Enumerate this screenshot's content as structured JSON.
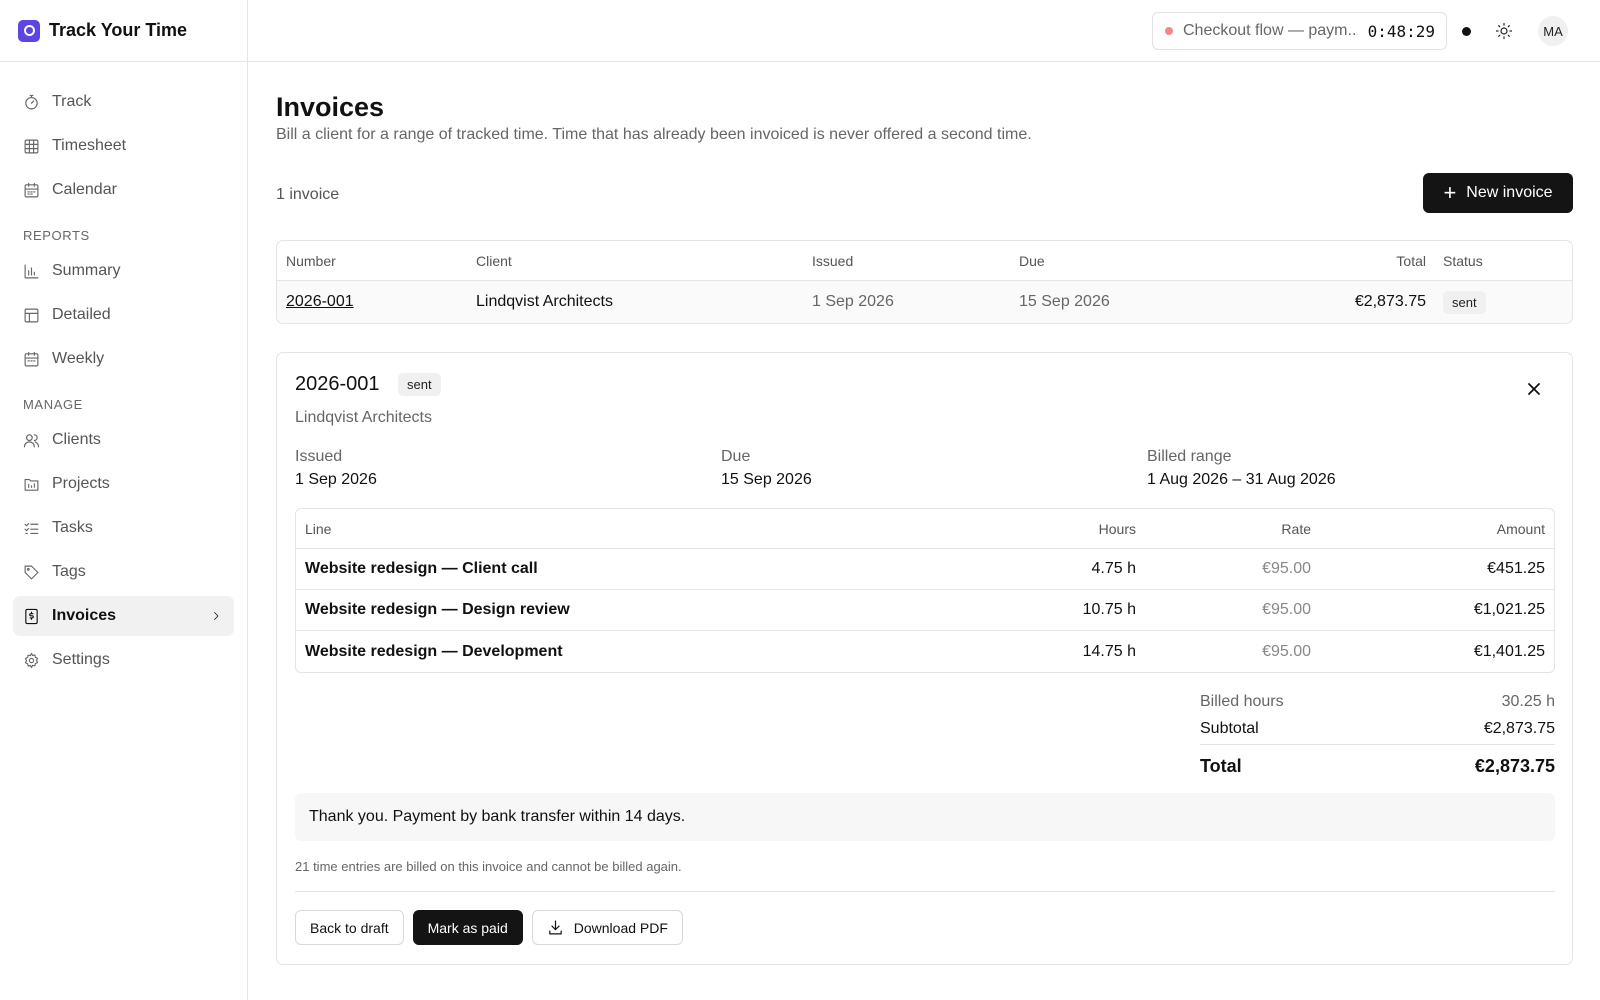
{
  "app": {
    "title": "Track Your Time"
  },
  "sidebar": {
    "top_items": [
      {
        "label": "Track",
        "icon": "stopwatch-icon"
      },
      {
        "label": "Timesheet",
        "icon": "grid-icon"
      },
      {
        "label": "Calendar",
        "icon": "calendar-icon"
      }
    ],
    "reports_heading": "REPORTS",
    "reports_items": [
      {
        "label": "Summary",
        "icon": "bar-chart-icon"
      },
      {
        "label": "Detailed",
        "icon": "table-icon"
      },
      {
        "label": "Weekly",
        "icon": "calendar-week-icon"
      }
    ],
    "manage_heading": "MANAGE",
    "manage_items": [
      {
        "label": "Clients",
        "icon": "users-icon"
      },
      {
        "label": "Projects",
        "icon": "folder-icon"
      },
      {
        "label": "Tasks",
        "icon": "checklist-icon"
      },
      {
        "label": "Tags",
        "icon": "tag-icon"
      },
      {
        "label": "Invoices",
        "icon": "invoice-icon",
        "active": true
      },
      {
        "label": "Settings",
        "icon": "gear-icon"
      }
    ]
  },
  "topbar": {
    "timer_label": "Checkout flow — paym...",
    "timer_time": "0:48:29",
    "avatar_initials": "MA"
  },
  "page": {
    "title": "Invoices",
    "subtitle": "Bill a client for a range of tracked time. Time that has already been invoiced is never offered a second time.",
    "count": "1 invoice",
    "new_button": "New invoice"
  },
  "invoice_table": {
    "headers": {
      "number": "Number",
      "client": "Client",
      "issued": "Issued",
      "due": "Due",
      "total": "Total",
      "status": "Status"
    },
    "rows": [
      {
        "number": "2026-001",
        "client": "Lindqvist Architects",
        "issued": "1 Sep 2026",
        "due": "15 Sep 2026",
        "total": "€2,873.75",
        "status": "sent"
      }
    ]
  },
  "detail": {
    "number": "2026-001",
    "status": "sent",
    "client": "Lindqvist Architects",
    "issued_label": "Issued",
    "issued": "1 Sep 2026",
    "due_label": "Due",
    "due": "15 Sep 2026",
    "range_label": "Billed range",
    "range": "1 Aug 2026 – 31 Aug 2026",
    "lines_headers": {
      "line": "Line",
      "hours": "Hours",
      "rate": "Rate",
      "amount": "Amount"
    },
    "lines": [
      {
        "line": "Website redesign — Client call",
        "hours": "4.75 h",
        "rate": "€95.00",
        "amount": "€451.25"
      },
      {
        "line": "Website redesign — Design review",
        "hours": "10.75 h",
        "rate": "€95.00",
        "amount": "€1,021.25"
      },
      {
        "line": "Website redesign — Development",
        "hours": "14.75 h",
        "rate": "€95.00",
        "amount": "€1,401.25"
      }
    ],
    "totals": {
      "billed_hours_label": "Billed hours",
      "billed_hours": "30.25 h",
      "subtotal_label": "Subtotal",
      "subtotal": "€2,873.75",
      "total_label": "Total",
      "total": "€2,873.75"
    },
    "note": "Thank you. Payment by bank transfer within 14 days.",
    "billed_note": "21 time entries are billed on this invoice and cannot be billed again.",
    "actions": {
      "back_to_draft": "Back to draft",
      "mark_paid": "Mark as paid",
      "download_pdf": "Download PDF"
    }
  },
  "colors": {
    "brand": "#5b46e5",
    "primary_button": "#141414",
    "timer_dot": "#f08a8a"
  }
}
